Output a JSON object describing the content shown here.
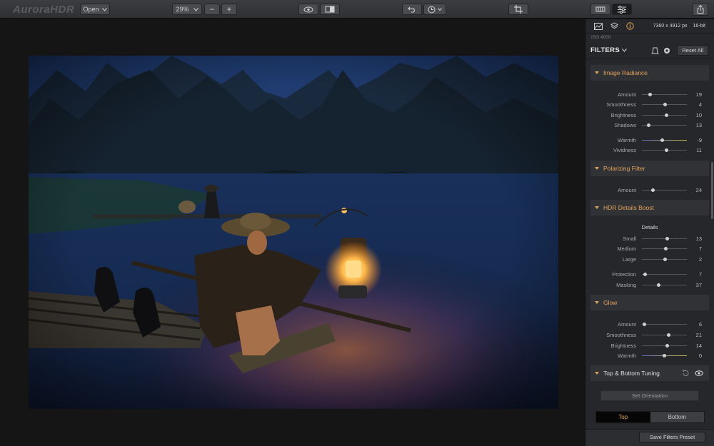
{
  "app": {
    "logo": "AuroraHDR"
  },
  "toolbar": {
    "open_label": "Open",
    "zoom_value": "29%",
    "zoom_out": "−",
    "zoom_in": "+"
  },
  "image": {
    "dimensions": "7360 x 4912 px",
    "bit_depth": "16-bit",
    "iso": "ISO 4000"
  },
  "panel": {
    "filters_title": "FILTERS",
    "reset_all": "Reset All",
    "sections": {
      "image_radiance": {
        "title": "Image Radiance",
        "sliders": [
          {
            "label": "Amount",
            "value": "19",
            "level": 0.19
          },
          {
            "label": "Smoothness",
            "value": "4",
            "level": 0.52
          },
          {
            "label": "Brightness",
            "value": "10",
            "level": 0.55
          },
          {
            "label": "Shadows",
            "value": "13",
            "level": 0.15
          },
          {
            "label": "Warmth",
            "value": "-9",
            "level": 0.45
          },
          {
            "label": "Vividness",
            "value": "11",
            "level": 0.55
          }
        ]
      },
      "polarizing": {
        "title": "Polarizing Filter",
        "sliders": [
          {
            "label": "Amount",
            "value": "24",
            "level": 0.24
          }
        ]
      },
      "hdr_details": {
        "title": "HDR Details Boost",
        "sublabel": "Details",
        "sliders": [
          {
            "label": "Small",
            "value": "13",
            "level": 0.56
          },
          {
            "label": "Medium",
            "value": "7",
            "level": 0.53
          },
          {
            "label": "Large",
            "value": "2",
            "level": 0.51
          },
          {
            "label": "Protection",
            "value": "7",
            "level": 0.07
          },
          {
            "label": "Masking",
            "value": "37",
            "level": 0.37
          }
        ]
      },
      "glow": {
        "title": "Glow",
        "sliders": [
          {
            "label": "Amount",
            "value": "6",
            "level": 0.06
          },
          {
            "label": "Smoothness",
            "value": "21",
            "level": 0.6
          },
          {
            "label": "Brightness",
            "value": "14",
            "level": 0.57
          },
          {
            "label": "Warmth",
            "value": "0",
            "level": 0.5
          }
        ]
      },
      "top_bottom": {
        "title": "Top & Bottom Tuning",
        "set_orientation": "Set Orientation",
        "top": "Top",
        "bottom": "Bottom"
      }
    },
    "save_preset": "Save Filters Preset"
  },
  "colors": {
    "accent": "#e4a35a",
    "panel_bg": "#26272a",
    "toolbar_bg": "#333437"
  }
}
